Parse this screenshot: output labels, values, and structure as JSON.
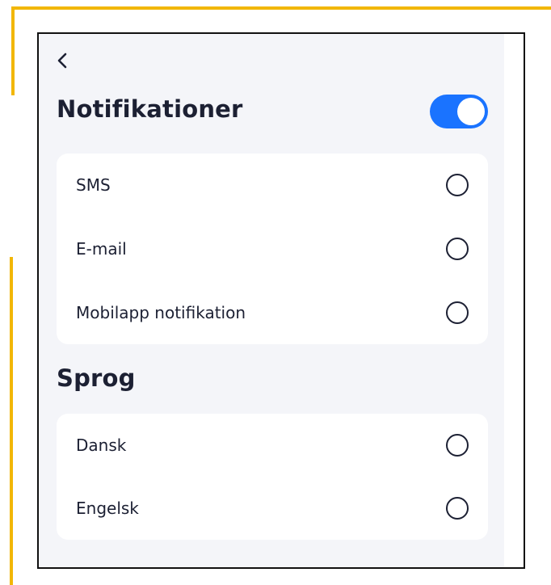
{
  "header": {
    "back_icon": "chevron-left-icon"
  },
  "notifications": {
    "title": "Notifikationer",
    "toggle_on": true,
    "accent_color": "#1a73ff",
    "options": [
      {
        "label": "SMS",
        "selected": false
      },
      {
        "label": "E-mail",
        "selected": false
      },
      {
        "label": "Mobilapp notifikation",
        "selected": false
      }
    ]
  },
  "language": {
    "title": "Sprog",
    "options": [
      {
        "label": "Dansk",
        "selected": false
      },
      {
        "label": "Engelsk",
        "selected": false
      }
    ]
  },
  "colors": {
    "background": "#f4f5f9",
    "card": "#ffffff",
    "text": "#1c2033",
    "annotation": "#f2b705"
  }
}
